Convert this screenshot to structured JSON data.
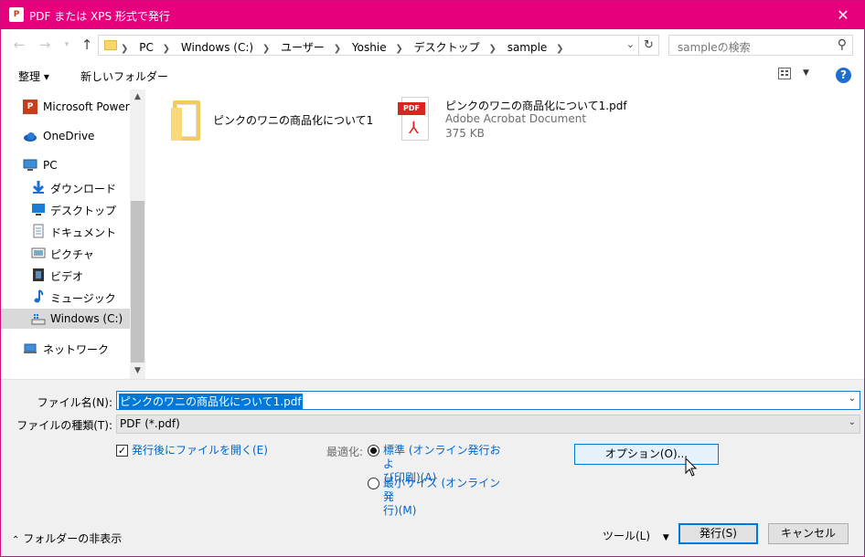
{
  "window": {
    "title": "PDF または XPS 形式で発行",
    "app_icon": "P",
    "close": "✕",
    "accent": "#e6007e"
  },
  "address": {
    "crumbs": [
      "PC",
      "Windows (C:)",
      "ユーザー",
      "Yoshie",
      "デスクトップ",
      "sample"
    ],
    "search_placeholder": "sampleの検索"
  },
  "toolbar": {
    "organize": "整理 ▾",
    "new_folder": "新しいフォルダー",
    "help": "?"
  },
  "nav": {
    "items": [
      {
        "label": "Microsoft PowerP",
        "icon": "powerpoint-icon"
      },
      {
        "label": "OneDrive",
        "icon": "onedrive-icon"
      },
      {
        "label": "PC",
        "icon": "pc-icon"
      },
      {
        "label": "ダウンロード",
        "icon": "download-icon"
      },
      {
        "label": "デスクトップ",
        "icon": "desktop-icon"
      },
      {
        "label": "ドキュメント",
        "icon": "document-icon"
      },
      {
        "label": "ピクチャ",
        "icon": "picture-icon"
      },
      {
        "label": "ビデオ",
        "icon": "video-icon"
      },
      {
        "label": "ミュージック",
        "icon": "music-icon"
      },
      {
        "label": "Windows (C:)",
        "icon": "drive-icon",
        "selected": true
      },
      {
        "label": "ネットワーク",
        "icon": "network-icon"
      }
    ]
  },
  "files": [
    {
      "name": "ピンクのワニの商品化について1",
      "type": "folder"
    },
    {
      "name": "ピンクのワニの商品化について1.pdf",
      "kind": "Adobe Acrobat Document",
      "size": "375 KB",
      "badge": "PDF"
    }
  ],
  "form": {
    "filename_label": "ファイル名(N):",
    "filename_value": "ピンクのワニの商品化について1.pdf",
    "filetype_label": "ファイルの種類(T):",
    "filetype_value": "PDF (*.pdf)",
    "open_after_label": "発行後にファイルを開く(E)",
    "open_after_checked": true,
    "optimize_label": "最適化:",
    "opt_standard_line1": "標準 (オンライン発行およ",
    "opt_standard_line2": "び印刷)(A)",
    "opt_min_line1": "最小サイズ (オンライン発",
    "opt_min_line2": "行)(M)",
    "options_button": "オプション(O)...",
    "hide_folders": "フォルダーの非表示",
    "tools": "ツール(L)",
    "publish": "発行(S)",
    "cancel": "キャンセル"
  }
}
